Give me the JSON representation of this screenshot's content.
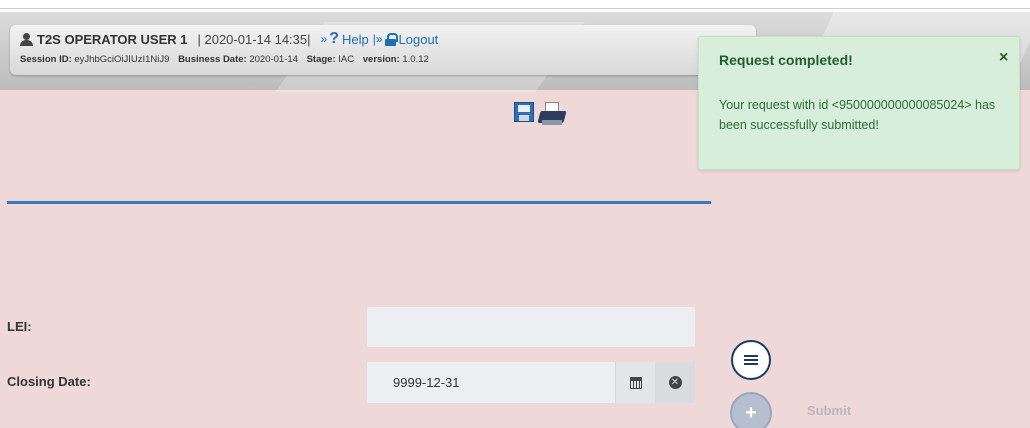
{
  "header": {
    "user_name": "T2S OPERATOR USER 1",
    "datetime": "| 2020-01-14 14:35|",
    "help_label": "Help",
    "logout_label": "Logout",
    "link_separator_1": "»",
    "link_separator_2": "|»",
    "session_label": "Session ID:",
    "session_value": "eyJhbGciOiJIUzI1NiJ9",
    "business_date_label": "Business Date:",
    "business_date_value": "2020-01-14",
    "stage_label": "Stage:",
    "stage_value": "IAC",
    "version_label": "version:",
    "version_value": "1.0.12"
  },
  "form": {
    "lei_label": "LEI:",
    "lei_value": "",
    "closing_date_label": "Closing Date:",
    "closing_date_value": "9999-12-31",
    "submit_label": "Submit"
  },
  "notification": {
    "title": "Request completed!",
    "close_glyph": "×",
    "message": "Your request with id <950000000000085024> has been successfully submitted!"
  },
  "icons": {
    "user": "user-icon",
    "help": "question-icon",
    "logout": "lock-icon",
    "save": "floppy-disk-icon",
    "print": "printer-icon",
    "calendar": "calendar-icon",
    "clear": "clear-circle-icon",
    "list": "list-icon",
    "add": "plus-icon",
    "close": "close-icon"
  },
  "colors": {
    "page_background": "#eed8d8",
    "link_blue": "#1f6fb6",
    "rule_blue": "#3b78bd",
    "toast_background": "#d7eedb",
    "toast_text": "#245e2d",
    "navy": "#1d3a64"
  }
}
